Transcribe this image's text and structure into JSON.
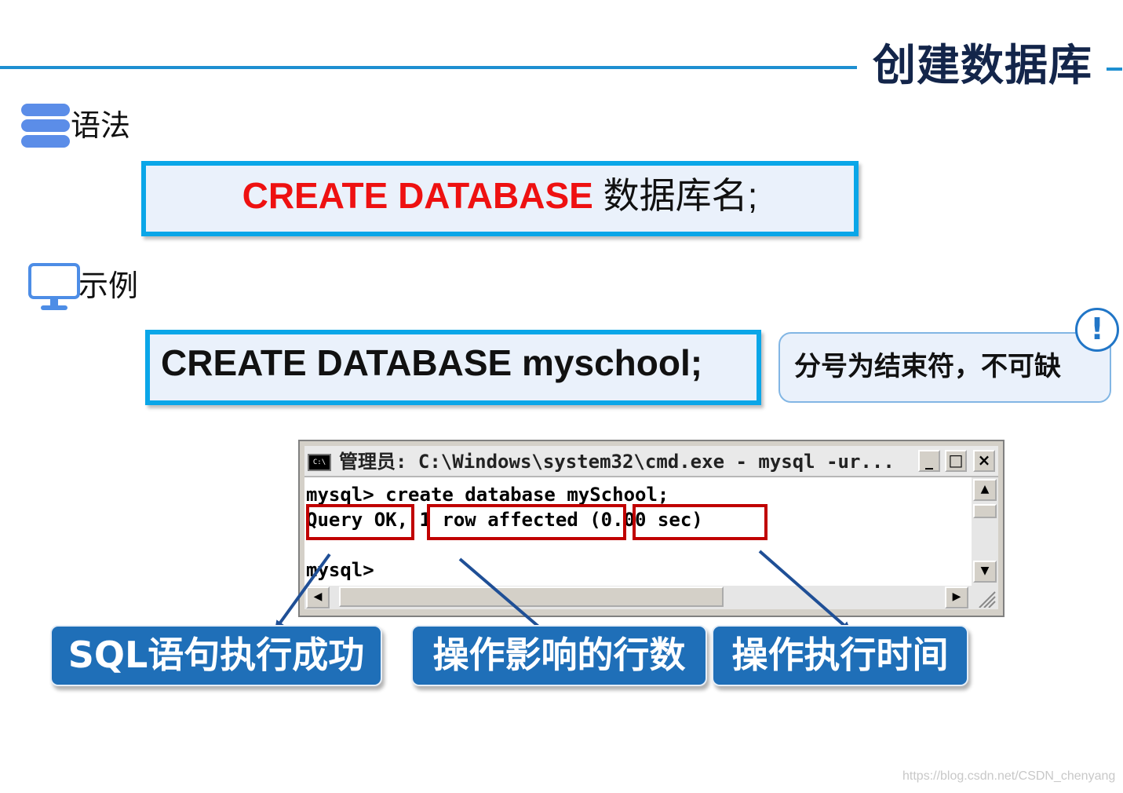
{
  "header": {
    "title": "创建数据库"
  },
  "syntax_section": {
    "label": "语法",
    "icon": "server-icon",
    "code": {
      "keyword": "CREATE DATABASE",
      "rest": " 数据库名;"
    }
  },
  "example_section": {
    "label": "示例",
    "icon": "monitor-icon",
    "code": "CREATE DATABASE myschool;"
  },
  "note": {
    "text": "分号为结束符，不可缺",
    "icon": "exclamation-icon",
    "badge": "!"
  },
  "terminal": {
    "icon_text": "C:\\",
    "title": "管理员: C:\\Windows\\system32\\cmd.exe - mysql  -ur...",
    "buttons": {
      "minimize": "_",
      "maximize": "□",
      "close": "×"
    },
    "scroll": {
      "up": "▲",
      "down": "▼",
      "left": "◀",
      "right": "▶"
    },
    "lines": [
      "mysql> create database mySchool;",
      "Query OK, 1 row affected (0.00 sec)",
      "",
      "mysql>"
    ]
  },
  "annotations": [
    {
      "label": "SQL语句执行成功"
    },
    {
      "label": "操作影响的行数"
    },
    {
      "label": "操作执行时间"
    }
  ],
  "colors": {
    "accent_blue": "#1e8fd1",
    "keyword_red": "#ee1111",
    "highlight_red": "#c00000",
    "callout_blue": "#1f6fb8",
    "title_navy": "#13254a"
  },
  "watermark": "https://blog.csdn.net/CSDN_chenyang"
}
